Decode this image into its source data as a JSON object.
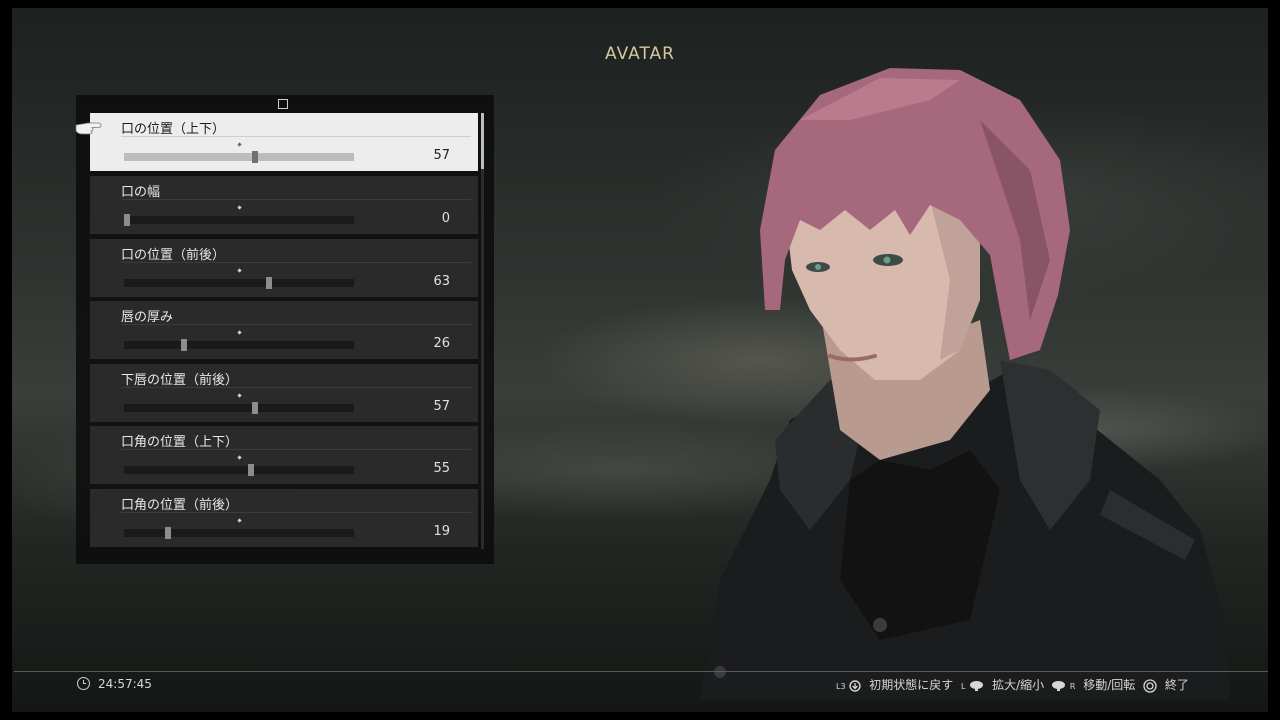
{
  "screen": {
    "title": "AVATAR"
  },
  "panel": {
    "tab_icon": "square-icon",
    "sliders": [
      {
        "label": "口の位置（上下）",
        "value": 57,
        "selected": true,
        "percent": 57
      },
      {
        "label": "口の幅",
        "value": 0,
        "selected": false,
        "percent": 0
      },
      {
        "label": "口の位置（前後）",
        "value": 63,
        "selected": false,
        "percent": 63
      },
      {
        "label": "唇の厚み",
        "value": 26,
        "selected": false,
        "percent": 26
      },
      {
        "label": "下唇の位置（前後）",
        "value": 57,
        "selected": false,
        "percent": 57
      },
      {
        "label": "口角の位置（上下）",
        "value": 55,
        "selected": false,
        "percent": 55
      },
      {
        "label": "口角の位置（前後）",
        "value": 19,
        "selected": false,
        "percent": 19
      }
    ],
    "default_marker_percent": 50
  },
  "cursor_icon": "pointing-hand-icon",
  "footer": {
    "clock_icon": "clock-icon",
    "time": "24:57:45",
    "hints": {
      "reset": {
        "button": "L3",
        "label": "初期状態に戻す"
      },
      "zoom": {
        "button": "L",
        "label": "拡大/縮小"
      },
      "move": {
        "button": "R",
        "label": "移動/回転"
      },
      "exit": {
        "button": "circle",
        "label": "終了"
      }
    }
  }
}
